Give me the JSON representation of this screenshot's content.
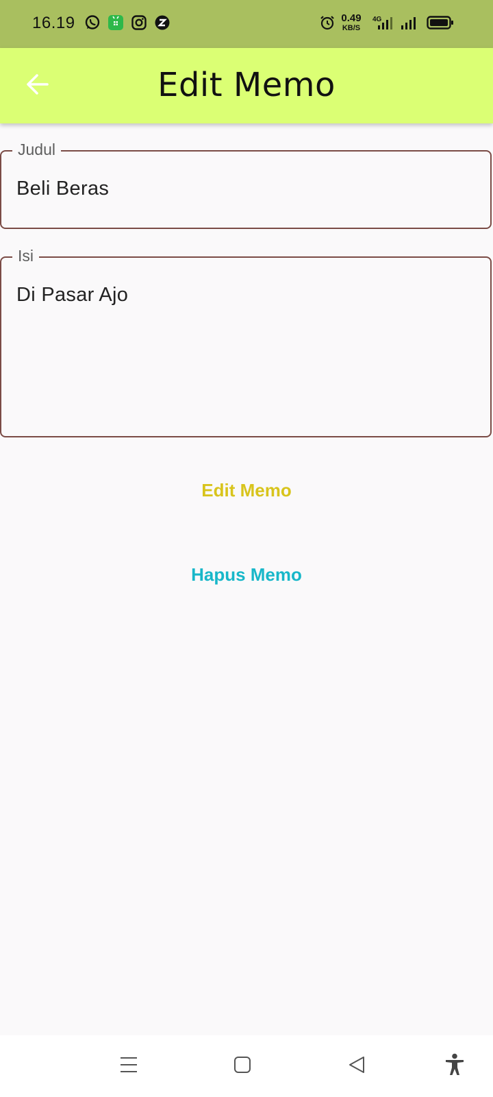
{
  "status_bar": {
    "time": "16.19",
    "net_speed_value": "0.49",
    "net_speed_unit": "KB/S",
    "network_type": "4G",
    "icons": [
      "whatsapp-icon",
      "store-icon",
      "instagram-icon",
      "z-app-icon",
      "alarm-icon",
      "signal-icon",
      "battery-icon"
    ]
  },
  "app_bar": {
    "title": "Edit Memo",
    "back_icon": "arrow-left-icon",
    "background": "#dbff74"
  },
  "form": {
    "title_field": {
      "label": "Judul",
      "value": "Beli Beras"
    },
    "content_field": {
      "label": "Isi",
      "value": "Di Pasar Ajo"
    },
    "border_color": "#7a4b45"
  },
  "actions": {
    "edit_label": "Edit Memo",
    "edit_color": "#d8c41c",
    "delete_label": "Hapus Memo",
    "delete_color": "#18b7c9"
  },
  "nav_bar": {
    "icons": [
      "menu-icon",
      "home-icon",
      "back-icon",
      "accessibility-icon"
    ]
  }
}
